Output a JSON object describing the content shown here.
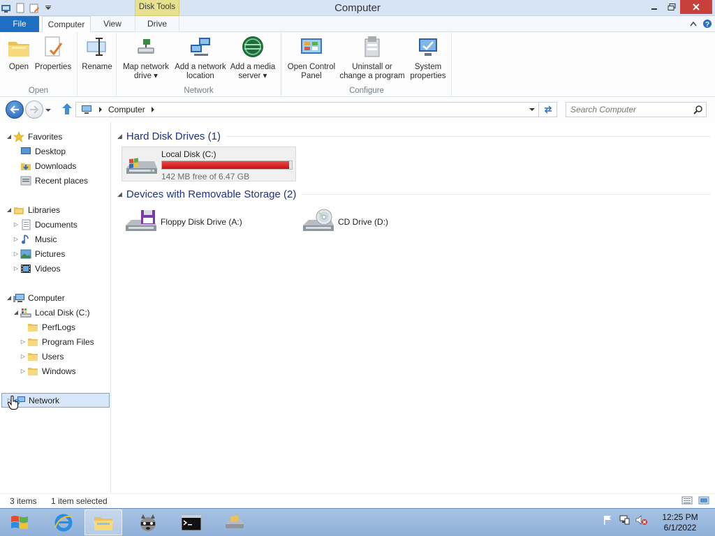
{
  "window": {
    "title": "Computer",
    "context_tab_group": "Disk Tools"
  },
  "ribbon_tabs": [
    "File",
    "Computer",
    "View",
    "Drive"
  ],
  "ribbon": {
    "groups": [
      {
        "label": "Open",
        "buttons": [
          "Open",
          "Properties",
          "Rename"
        ]
      },
      {
        "label": "Network",
        "buttons": [
          "Map network\ndrive ▾",
          "Add a network\nlocation",
          "Add a media\nserver ▾"
        ]
      },
      {
        "label": "Configure",
        "buttons": [
          "Open Control\nPanel",
          "Uninstall or\nchange a program",
          "System\nproperties"
        ]
      }
    ]
  },
  "address": {
    "path": [
      "Computer"
    ],
    "search_placeholder": "Search Computer"
  },
  "nav_tree": {
    "favorites": {
      "label": "Favorites",
      "items": [
        "Desktop",
        "Downloads",
        "Recent places"
      ]
    },
    "libraries": {
      "label": "Libraries",
      "items": [
        "Documents",
        "Music",
        "Pictures",
        "Videos"
      ]
    },
    "computer": {
      "label": "Computer",
      "drive": "Local Disk (C:)",
      "folders": [
        "PerfLogs",
        "Program Files",
        "Users",
        "Windows"
      ]
    },
    "network": {
      "label": "Network"
    }
  },
  "content": {
    "groups": [
      {
        "header": "Hard Disk Drives (1)",
        "items": [
          {
            "name": "Local Disk (C:)",
            "free": "142 MB free of 6.47 GB",
            "used_fraction": 0.979
          }
        ]
      },
      {
        "header": "Devices with Removable Storage (2)",
        "items": [
          {
            "name": "Floppy Disk Drive (A:)"
          },
          {
            "name": "CD Drive (D:)"
          }
        ]
      }
    ]
  },
  "status": {
    "item_count": "3 items",
    "selection": "1 item selected"
  },
  "clock": {
    "time": "12:25 PM",
    "date": "6/1/2022"
  },
  "colors": {
    "accent": "#1e6ec1",
    "disk_bar": "#d21a1a",
    "group_header": "#1e3287",
    "context_tab": "#e7e08f"
  }
}
